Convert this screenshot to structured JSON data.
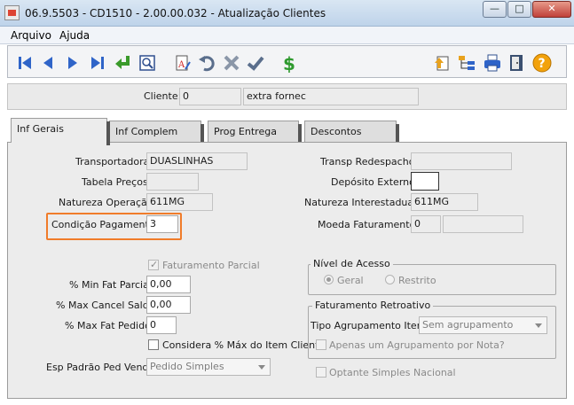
{
  "window": {
    "title": "06.9.5503 - CD1510 - 2.00.00.032 - Atualização Clientes",
    "min_glyph": "—",
    "max_glyph": "□",
    "close_glyph": "✕"
  },
  "menu": [
    "Arquivo",
    "Ajuda"
  ],
  "toolbar": {
    "left_icons": [
      "first-record-icon",
      "previous-record-icon",
      "next-record-icon",
      "last-record-icon",
      "return-icon",
      "preview-icon",
      "edit-icon",
      "undo-icon",
      "delete-icon",
      "confirm-icon",
      "currency-icon"
    ],
    "right_icons": [
      "upload-icon",
      "tree-icon",
      "printer-icon",
      "exit-door-icon",
      "help-icon"
    ]
  },
  "client": {
    "label": "Cliente:",
    "code": "0",
    "name": "extra fornec"
  },
  "tabs": [
    "Inf Gerais",
    "Inf Complem",
    "Prog Entrega",
    "Descontos"
  ],
  "form": {
    "transportadora": {
      "label": "Transportadora:",
      "value": "DUASLINHAS"
    },
    "tabela_precos": {
      "label": "Tabela Preços:",
      "value": ""
    },
    "natureza_operacao": {
      "label": "Natureza Operação:",
      "value": "611MG"
    },
    "condicao_pagamento": {
      "label": "Condição Pagamento:",
      "value": "3"
    },
    "transp_redespacho": {
      "label": "Transp Redespacho:",
      "value": ""
    },
    "deposito_externo": {
      "label": "Depósito Externo:",
      "value": ""
    },
    "natureza_interestadual": {
      "label": "Natureza Interestadual:",
      "value": "611MG"
    },
    "moeda_faturamento": {
      "label": "Moeda Faturamento:",
      "code": "0",
      "desc": ""
    }
  },
  "faturamento": {
    "parcial_label": "Faturamento Parcial",
    "min_fat_parcial": {
      "label": "% Min Fat Parcial:",
      "value": "0,00"
    },
    "max_cancel_saldo": {
      "label": "% Max Cancel Saldo:",
      "value": "0,00"
    },
    "max_fat_pedido": {
      "label": "% Max Fat Pedido:",
      "value": "0"
    },
    "considera_label": "Considera % Máx do Item Cliente"
  },
  "esp_padrao": {
    "label": "Esp Padrão Ped Venda:",
    "value": "Pedido Simples"
  },
  "nivel_acesso": {
    "legend": "Nível de Acesso",
    "geral": "Geral",
    "restrito": "Restrito"
  },
  "fat_retroativo": {
    "legend": "Faturamento Retroativo",
    "tipo_label": "Tipo Agrupamento Itens:",
    "tipo_value": "Sem agrupamento",
    "apenas_label": "Apenas um Agrupamento por Nota?"
  },
  "optante_label": "Optante Simples Nacional"
}
